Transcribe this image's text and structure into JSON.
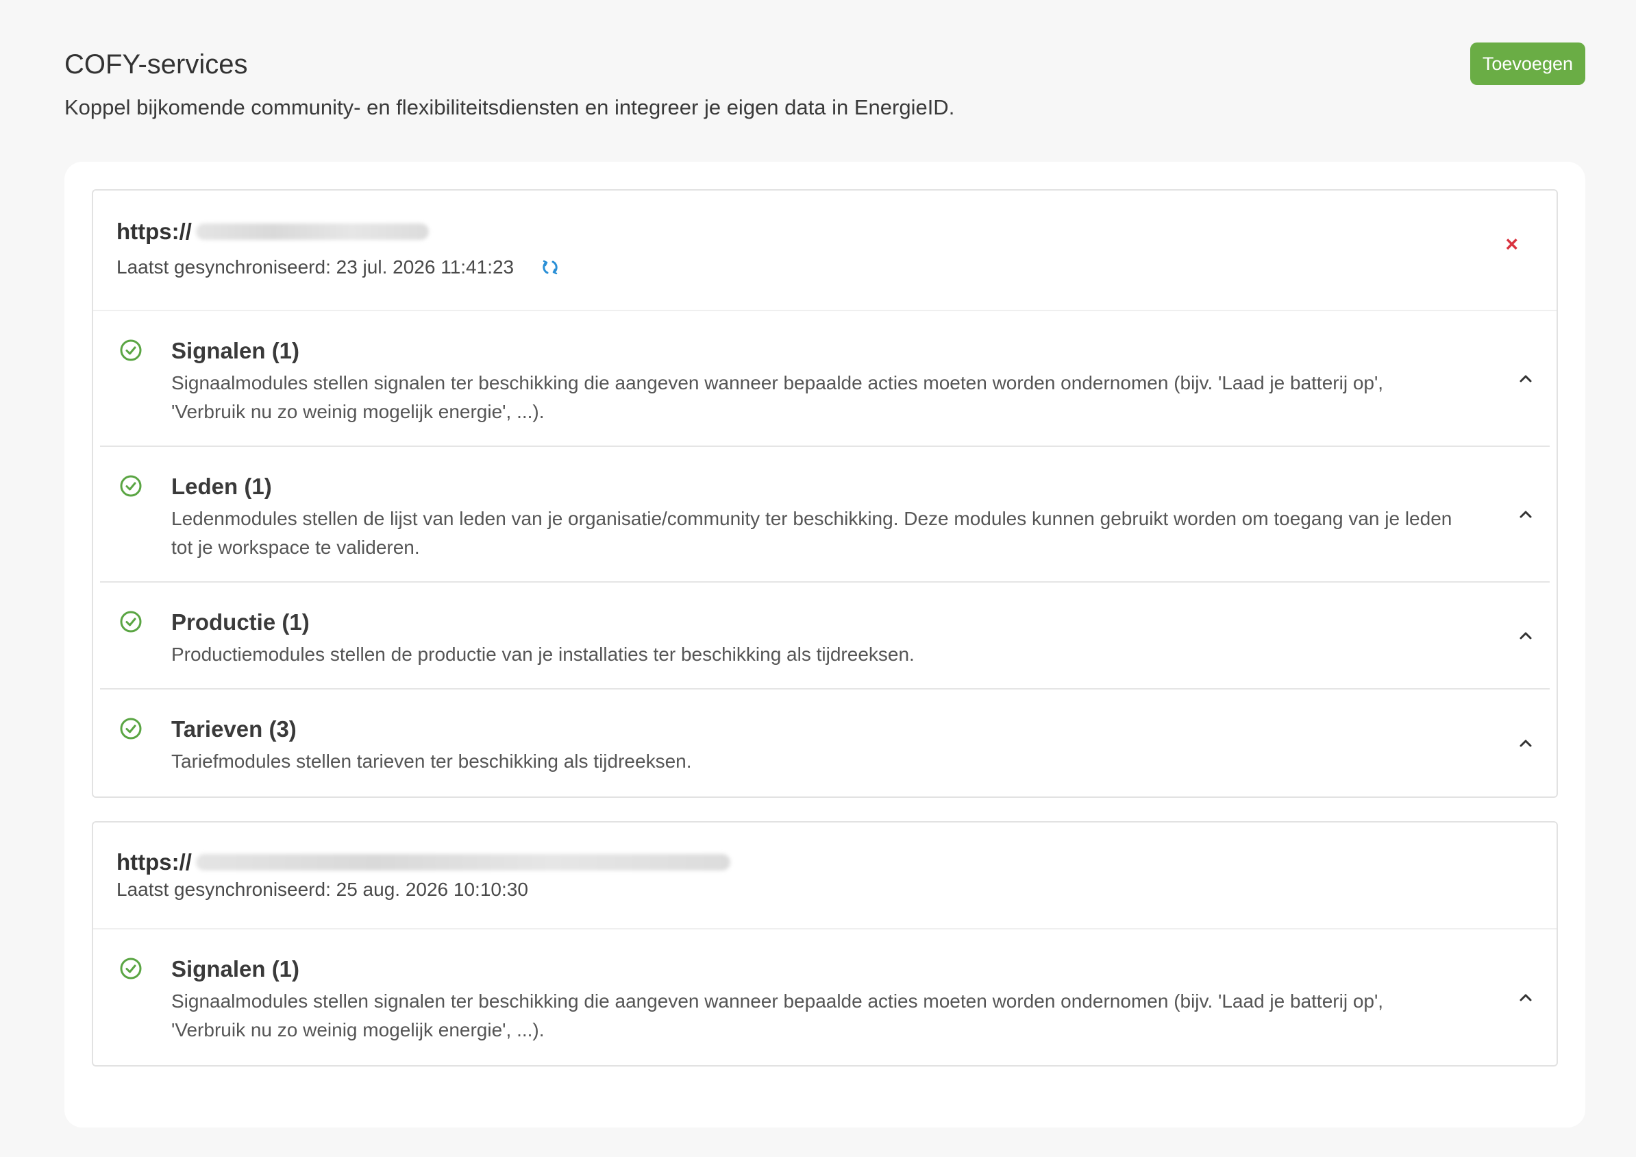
{
  "header": {
    "title": "COFY-services",
    "description": "Koppel bijkomende community- en flexibiliteitsdiensten en integreer je eigen data in EnergieID.",
    "add_label": "Toevoegen"
  },
  "services": [
    {
      "url_prefix": "https://",
      "sync_text": "Laatst gesynchroniseerd: 23 jul. 2026 11:41:23",
      "icons": [
        "refresh-icon",
        "close-icon"
      ],
      "modules": [
        {
          "title": "Signalen (1)",
          "description": "Signaalmodules stellen signalen ter beschikking die aangeven wanneer bepaalde acties moeten worden ondernomen (bijv. 'Laad je batterij op', 'Verbruik nu zo weinig mogelijk energie', ...)."
        },
        {
          "title": "Leden (1)",
          "description": "Ledenmodules stellen de lijst van leden van je organisatie/community ter beschikking. Deze modules kunnen gebruikt worden om toegang van je leden tot je workspace te valideren."
        },
        {
          "title": "Productie (1)",
          "description": "Productiemodules stellen de productie van je installaties ter beschikking als tijdreeksen."
        },
        {
          "title": "Tarieven (3)",
          "description": "Tariefmodules stellen tarieven ter beschikking als tijdreeksen."
        }
      ]
    },
    {
      "url_prefix": "https://",
      "sync_text": "Laatst gesynchroniseerd: 25 aug. 2026 10:10:30",
      "modules": [
        {
          "title": "Signalen (1)",
          "description": "Signaalmodules stellen signalen ter beschikking die aangeven wanneer bepaalde acties moeten worden ondernomen (bijv. 'Laad je batterij op', 'Verbruik nu zo weinig mogelijk energie', ...)."
        }
      ]
    }
  ],
  "colors": {
    "accent": "#6aad45",
    "danger": "#d9333f",
    "sync": "#2a8fd6",
    "check": "#5aa543"
  }
}
